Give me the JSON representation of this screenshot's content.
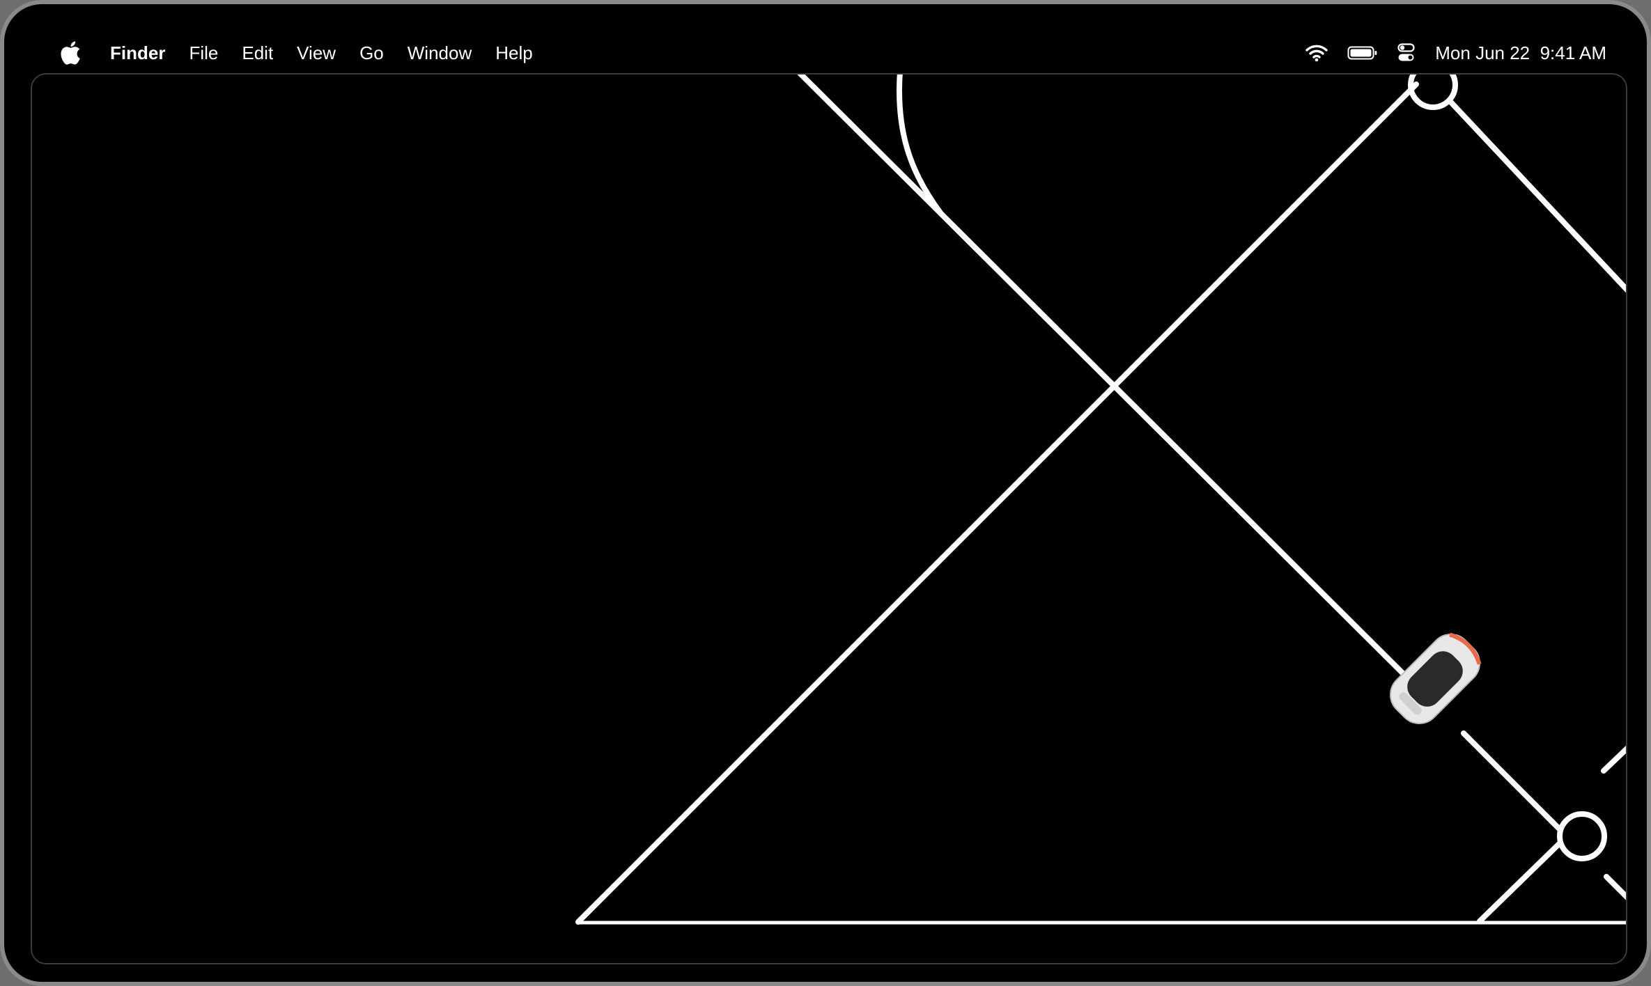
{
  "menubar": {
    "apple_icon": "apple-logo-icon",
    "app_name": "Finder",
    "menus": [
      "File",
      "Edit",
      "View",
      "Go",
      "Window",
      "Help"
    ],
    "status_icons": [
      "wifi-icon",
      "battery-icon",
      "control-center-icon"
    ],
    "date": "Mon Jun 22",
    "time": "9:41 AM"
  },
  "screen": {
    "content": "map-game",
    "colors": {
      "background": "#000000",
      "road": "#ffffff",
      "car_body": "#e8e8e8",
      "car_roof": "#2a2a2a",
      "car_accent": "#e86a4a"
    }
  }
}
